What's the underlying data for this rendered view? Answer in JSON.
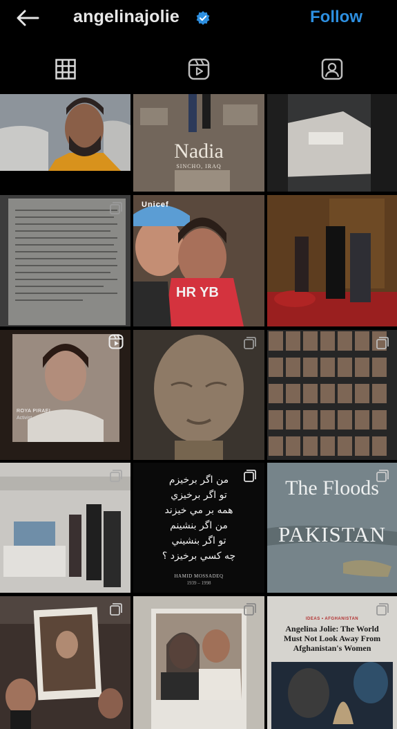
{
  "header": {
    "username": "angelinajolie",
    "follow_label": "Follow",
    "back_icon": "back-arrow-icon",
    "verified_icon": "verified-badge-icon",
    "accent_color": "#2d8fe0"
  },
  "tabs": [
    {
      "icon": "grid-icon",
      "selected": true
    },
    {
      "icon": "reels-icon",
      "selected": false
    },
    {
      "icon": "tagged-icon",
      "selected": false
    }
  ],
  "posts": {
    "p2": {
      "title": "Nadia",
      "subtitle": "SINCHO, IRAQ"
    },
    "p4": {
      "cap_name": "Unicef",
      "shirt": "HR YB"
    },
    "p7": {
      "name_caption": "ROYA PIRAEI",
      "role_caption": "Activist"
    },
    "p11": {
      "poem": [
        "من اگر برخیزم",
        "تو اگر برخیزي",
        "همه بر مي خيزند",
        "من اگر بنشينم",
        "تو اگر بنشيني",
        "چه كسي برخيزد ؟"
      ],
      "author": "HAMID MOSSADEQ",
      "years": "1939 – 1998"
    },
    "p12": {
      "title": "The Floods",
      "subtitle": "PAKISTAN"
    },
    "p15": {
      "kicker": "IDEAS • AFGHANISTAN",
      "headline": "Angelina Jolie: The World Must Not Look Away From Afghanistan's Women"
    }
  }
}
